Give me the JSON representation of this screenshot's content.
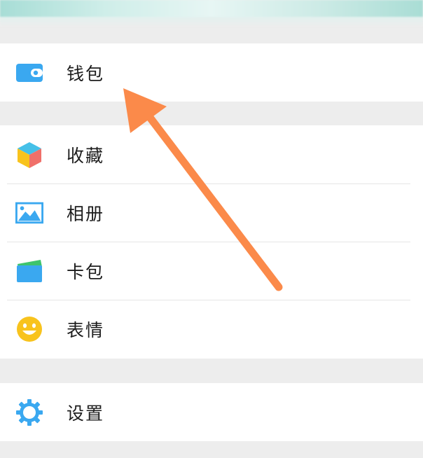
{
  "menu": {
    "wallet": {
      "label": "钱包",
      "icon": "wallet-icon"
    },
    "favorites": {
      "label": "收藏",
      "icon": "cube-icon"
    },
    "album": {
      "label": "相册",
      "icon": "picture-icon"
    },
    "cards": {
      "label": "卡包",
      "icon": "card-icon"
    },
    "stickers": {
      "label": "表情",
      "icon": "smiley-icon"
    },
    "settings": {
      "label": "设置",
      "icon": "gear-icon"
    }
  },
  "annotation": {
    "color": "#fb8a4a",
    "points_to": "wallet"
  },
  "colors": {
    "background": "#ededed",
    "row": "#ffffff",
    "icon_blue": "#3aa8f0",
    "icon_yellow": "#f8c31d"
  }
}
